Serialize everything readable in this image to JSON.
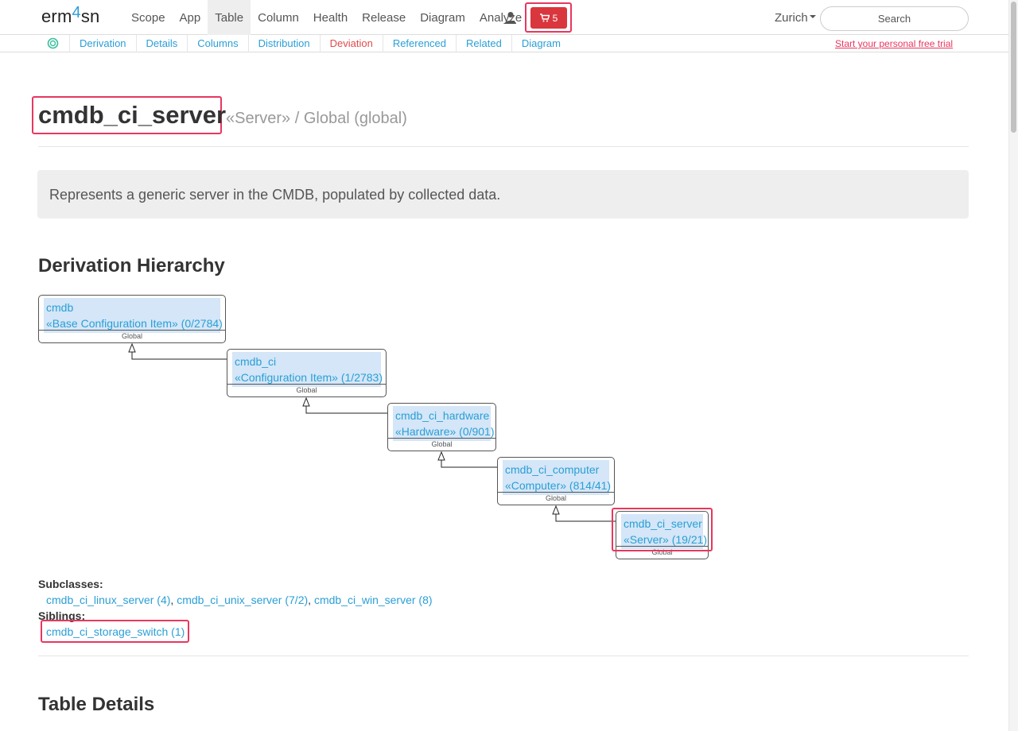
{
  "brand": {
    "prefix": "erm",
    "digit": "4",
    "suffix": "sn"
  },
  "nav": {
    "items": [
      "Scope",
      "App",
      "Table",
      "Column",
      "Health",
      "Release",
      "Diagram",
      "Analyze"
    ],
    "active": "Table",
    "cart_count": "5",
    "region": "Zurich",
    "search_placeholder": "Search"
  },
  "subnav": {
    "tabs": [
      "Derivation",
      "Details",
      "Columns",
      "Distribution",
      "Deviation",
      "Referenced",
      "Related",
      "Diagram"
    ],
    "current": "Deviation",
    "trial_link": "Start your personal free trial"
  },
  "page": {
    "title": "cmdb_ci_server",
    "subtitle": "«Server» / Global (global)",
    "description": "Represents a generic server in the CMDB, populated by collected data."
  },
  "derivation": {
    "heading": "Derivation Hierarchy",
    "nodes": [
      {
        "name": "cmdb",
        "label": "«Base Configuration Item» (0/2784)",
        "scope": "Global"
      },
      {
        "name": "cmdb_ci",
        "label": "«Configuration Item» (1/2783)",
        "scope": "Global"
      },
      {
        "name": "cmdb_ci_hardware",
        "label": "«Hardware» (0/901)",
        "scope": "Global"
      },
      {
        "name": "cmdb_ci_computer",
        "label": "«Computer» (814/41)",
        "scope": "Global"
      },
      {
        "name": "cmdb_ci_server",
        "label": "«Server» (19/21)",
        "scope": "Global"
      }
    ],
    "subclasses_label": "Subclasses:",
    "subclasses": [
      "cmdb_ci_linux_server (4)",
      "cmdb_ci_unix_server (7/2)",
      "cmdb_ci_win_server (8)"
    ],
    "siblings_label": "Siblings:",
    "siblings": [
      "cmdb_ci_storage_switch (1)"
    ]
  },
  "table_details": {
    "heading": "Table Details"
  },
  "colors": {
    "accent": "#2a9fd6",
    "highlight": "#e8375f",
    "cart": "#d9363e",
    "current_tab": "#e24a4a"
  }
}
